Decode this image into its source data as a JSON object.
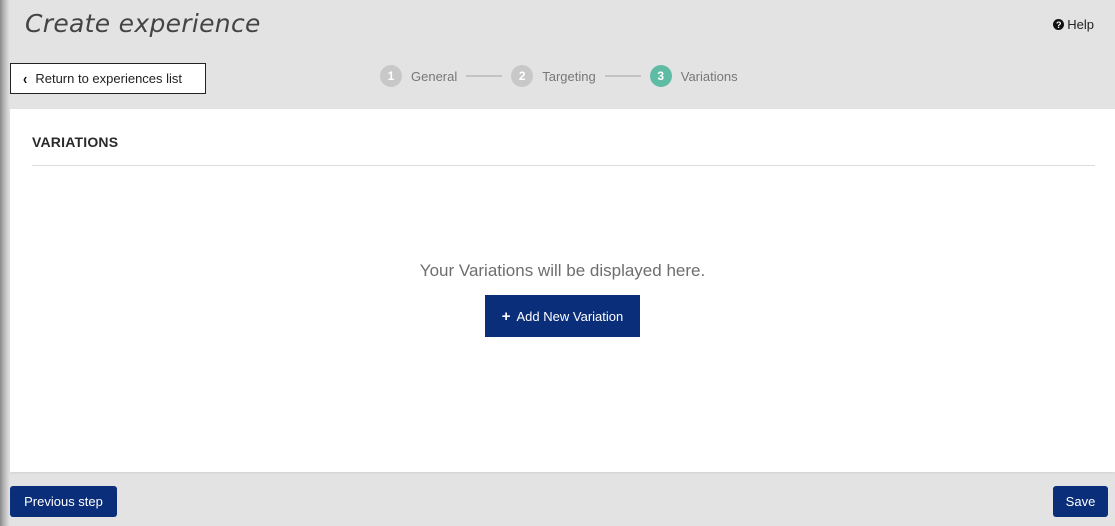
{
  "header": {
    "title": "Create experience",
    "help_label": "Help",
    "help_icon": "question-circle-icon",
    "return_label": "Return to experiences list",
    "return_icon": "chevron-left-icon"
  },
  "stepper": {
    "steps": [
      {
        "number": "1",
        "label": "General",
        "active": false
      },
      {
        "number": "2",
        "label": "Targeting",
        "active": false
      },
      {
        "number": "3",
        "label": "Variations",
        "active": true
      }
    ],
    "active_color": "#5fbca4",
    "inactive_color": "#c8c8c8"
  },
  "panel": {
    "title": "VARIATIONS",
    "empty_message": "Your Variations will be displayed here.",
    "add_button_label": "Add New Variation",
    "add_button_icon": "plus-icon"
  },
  "footer": {
    "previous_label": "Previous step",
    "save_label": "Save"
  },
  "colors": {
    "primary": "#0a2e7a",
    "background": "#e3e3e3"
  }
}
